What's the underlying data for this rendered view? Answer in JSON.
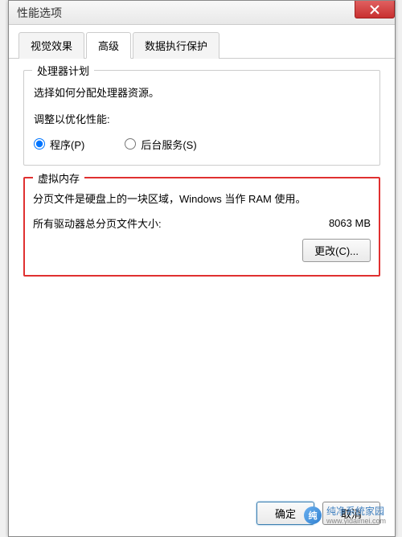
{
  "window": {
    "title": "性能选项"
  },
  "tabs": [
    {
      "label": "视觉效果"
    },
    {
      "label": "高级"
    },
    {
      "label": "数据执行保护"
    }
  ],
  "processor": {
    "group_title": "处理器计划",
    "description": "选择如何分配处理器资源。",
    "adjust_label": "调整以优化性能:",
    "radio_programs": "程序(P)",
    "radio_background": "后台服务(S)"
  },
  "virtual_memory": {
    "group_title": "虚拟内存",
    "description": "分页文件是硬盘上的一块区域，Windows 当作 RAM 使用。",
    "total_label": "所有驱动器总分页文件大小:",
    "total_value": "8063 MB",
    "change_button": "更改(C)..."
  },
  "buttons": {
    "ok": "确定",
    "cancel": "取消"
  },
  "watermark": {
    "brand": "纯净系统家园",
    "url": "www.yidaimei.com"
  },
  "colors": {
    "highlight_border": "#e03030",
    "close_button": "#c83030"
  }
}
